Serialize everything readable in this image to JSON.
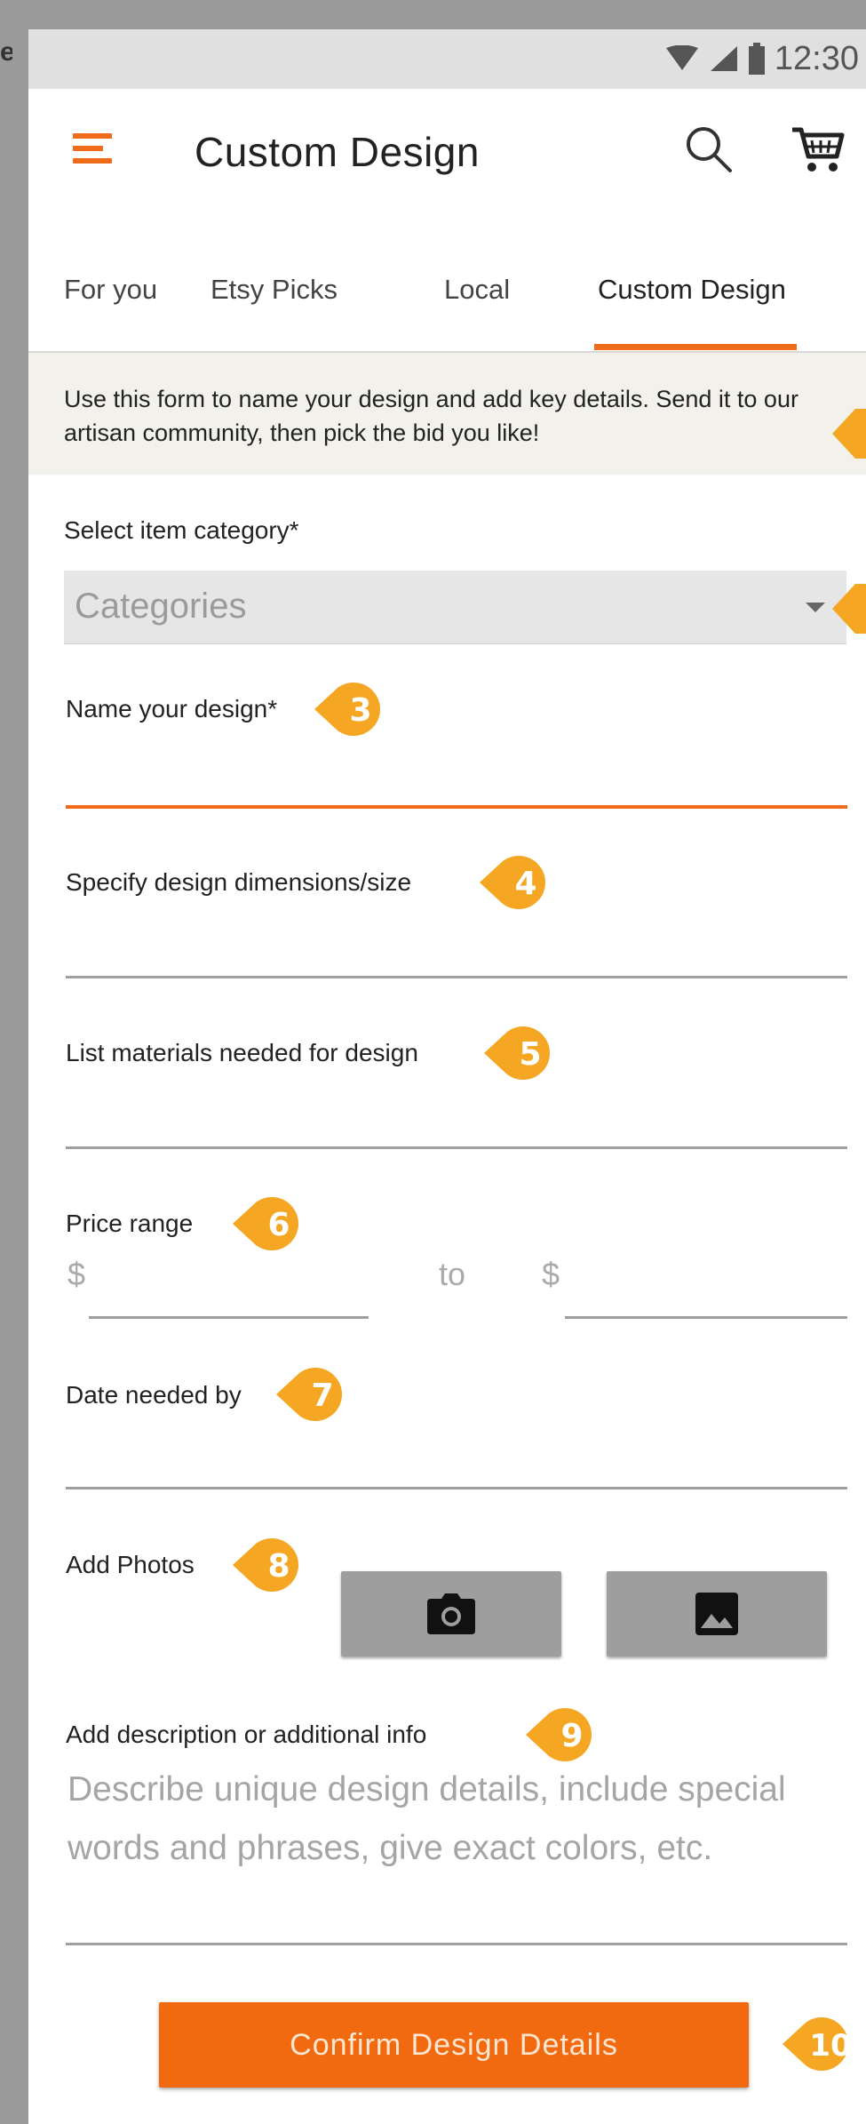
{
  "edge_text": "e",
  "status_bar": {
    "time": "12:30",
    "icons": [
      "wifi-icon",
      "signal-icon",
      "battery-icon"
    ]
  },
  "app_bar": {
    "title": "Custom Design",
    "icons": [
      "menu-icon",
      "search-icon",
      "cart-icon"
    ]
  },
  "tabs": [
    {
      "label": "For you",
      "active": false
    },
    {
      "label": "Etsy Picks",
      "active": false
    },
    {
      "label": "Local",
      "active": false
    },
    {
      "label": "Custom Design",
      "active": true
    }
  ],
  "info_banner": {
    "text": "Use this form to name your design and add key details. Send it to our artisan community, then pick the bid you like!"
  },
  "form": {
    "category_label": "Select item category*",
    "category_placeholder": "Categories",
    "name_label": "Name your design*",
    "dimensions_label": "Specify design dimensions/size",
    "materials_label": "List materials needed for design",
    "price_label": "Price range",
    "price_currency": "$",
    "price_to": "to",
    "date_label": "Date needed by",
    "photos_label": "Add Photos",
    "description_label": "Add description or additional info",
    "description_placeholder": "Describe unique design details, include special words and phrases, give exact colors, etc.",
    "confirm_label": "Confirm Design Details"
  },
  "badges": [
    "3",
    "4",
    "5",
    "6",
    "7",
    "8",
    "9",
    "10"
  ],
  "colors": {
    "accent": "#f06c1b",
    "badge": "#f5a623",
    "button": "#f26a10"
  }
}
